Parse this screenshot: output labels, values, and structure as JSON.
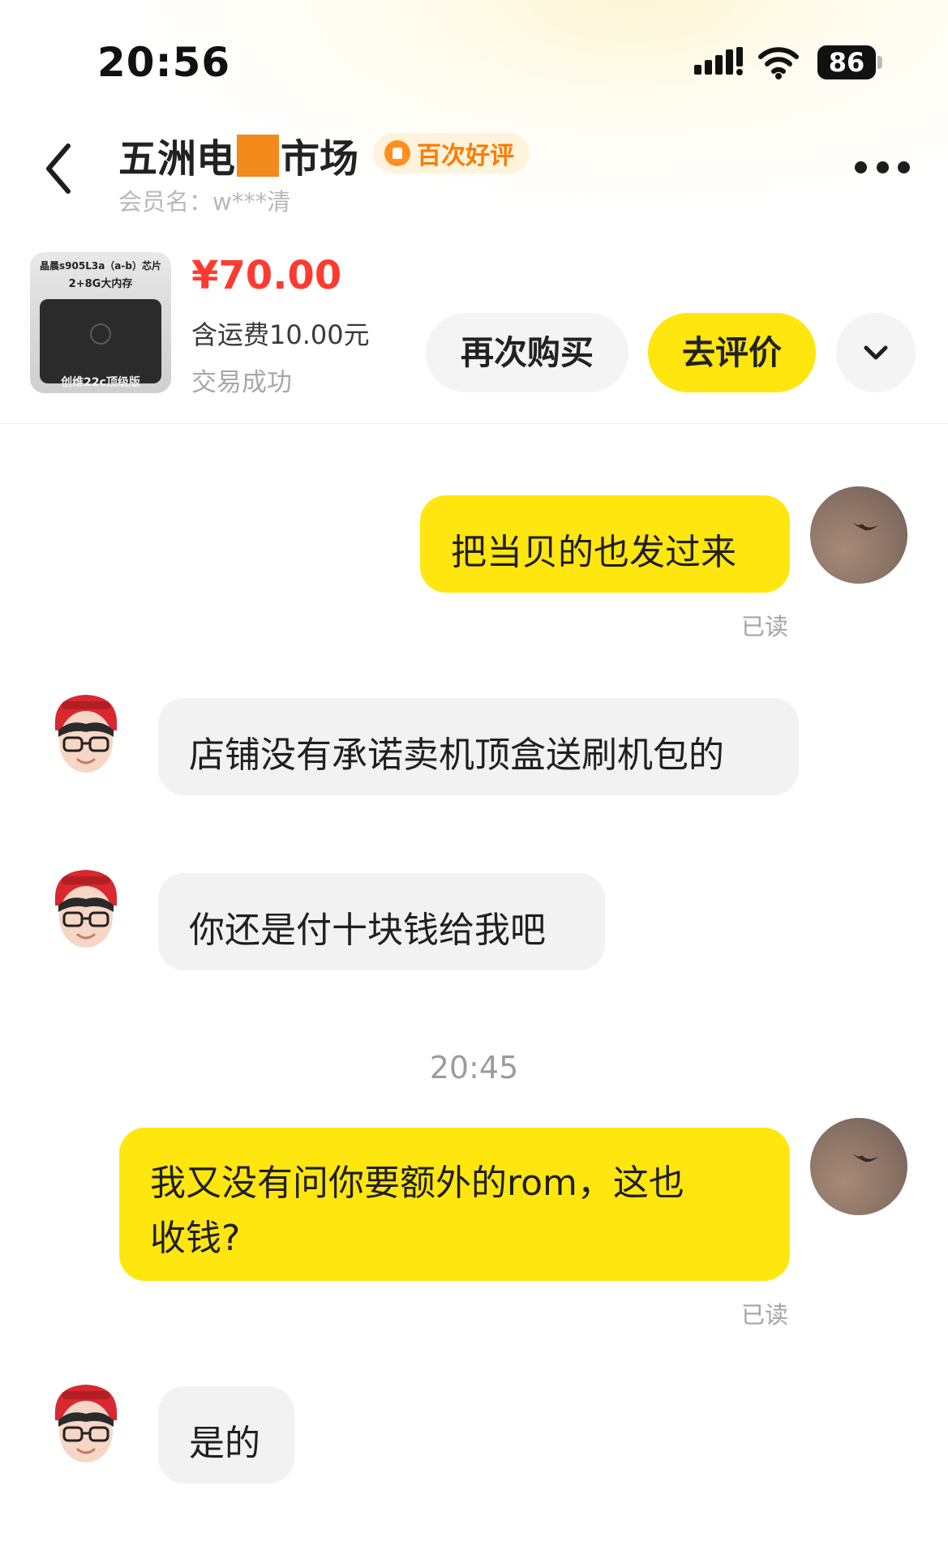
{
  "status_bar": {
    "time": "20:56",
    "battery": "86"
  },
  "header": {
    "shop_name_part1": "五洲电",
    "shop_name_part2": "市场",
    "badge": "百次好评",
    "member": "会员名：w***清"
  },
  "product": {
    "thumb_line1": "晶晨s905L3a（a-b）芯片",
    "thumb_line2": "2+8G大内存",
    "thumb_caption": "创维22c顶级版",
    "price": "¥70.00",
    "shipping": "含运费10.00元",
    "status": "交易成功",
    "rebuy_label": "再次购买",
    "review_label": "去评价"
  },
  "chat": {
    "messages": [
      {
        "from": "me",
        "lines": [
          "把当贝的也发过来"
        ],
        "status": "已读"
      },
      {
        "from": "them",
        "lines": [
          "店铺没有承诺卖机顶盒送刷机包的"
        ]
      },
      {
        "from": "them",
        "lines": [
          "你还是付十块钱给我吧"
        ]
      },
      {
        "from": "me",
        "lines": [
          "我又没有问你要额外的rom，这也",
          "收钱?"
        ],
        "status": "已读"
      },
      {
        "from": "them",
        "lines": [
          "是的"
        ]
      }
    ],
    "time_divider": "20:45"
  },
  "colors": {
    "accent_yellow": "#ffe60f",
    "price_red": "#ff3b30",
    "badge_orange": "#ff7a00",
    "mask_orange": "#f28a1c",
    "them_bubble": "#f2f2f2"
  },
  "icons": {
    "back": "chevron-left-icon",
    "more": "more-dots-icon",
    "expand": "chevron-down-icon",
    "badge": "thumbs-up-icon",
    "signal": "signal-icon",
    "wifi": "wifi-icon"
  }
}
